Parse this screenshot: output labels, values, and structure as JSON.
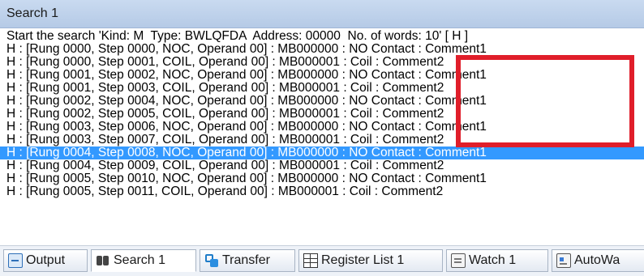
{
  "panel": {
    "title": "Search 1"
  },
  "results": {
    "lines": [
      "Start the search 'Kind: M  Type: BWLQFDA  Address: 00000  No. of words: 10' [ H ]",
      "H : [Rung 0000, Step 0000, NOC, Operand 00] : MB000000 : NO Contact : Comment1",
      "H : [Rung 0000, Step 0001, COIL, Operand 00] : MB000001 : Coil : Comment2",
      "H : [Rung 0001, Step 0002, NOC, Operand 00] : MB000000 : NO Contact : Comment1",
      "H : [Rung 0001, Step 0003, COIL, Operand 00] : MB000001 : Coil : Comment2",
      "H : [Rung 0002, Step 0004, NOC, Operand 00] : MB000000 : NO Contact : Comment1",
      "H : [Rung 0002, Step 0005, COIL, Operand 00] : MB000001 : Coil : Comment2",
      "H : [Rung 0003, Step 0006, NOC, Operand 00] : MB000000 : NO Contact : Comment1",
      "H : [Rung 0003, Step 0007, COIL, Operand 00] : MB000001 : Coil : Comment2",
      "H : [Rung 0004, Step 0008, NOC, Operand 00] : MB000000 : NO Contact : Comment1",
      "H : [Rung 0004, Step 0009, COIL, Operand 00] : MB000001 : Coil : Comment2",
      "H : [Rung 0005, Step 0010, NOC, Operand 00] : MB000000 : NO Contact : Comment1",
      "H : [Rung 0005, Step 0011, COIL, Operand 00] : MB000001 : Coil : Comment2"
    ],
    "selected_index": 9,
    "selection_color": "#3399ff",
    "highlight_color": "#e01e2a"
  },
  "tabs": [
    {
      "label": "Output",
      "icon": "output-icon"
    },
    {
      "label": "Search 1",
      "icon": "search-binoculars-icon",
      "active": true
    },
    {
      "label": "Transfer",
      "icon": "transfer-icon"
    },
    {
      "label": "Register List 1",
      "icon": "register-list-icon"
    },
    {
      "label": "Watch 1",
      "icon": "watch-icon"
    },
    {
      "label": "AutoWa",
      "icon": "autowatch-icon"
    }
  ]
}
